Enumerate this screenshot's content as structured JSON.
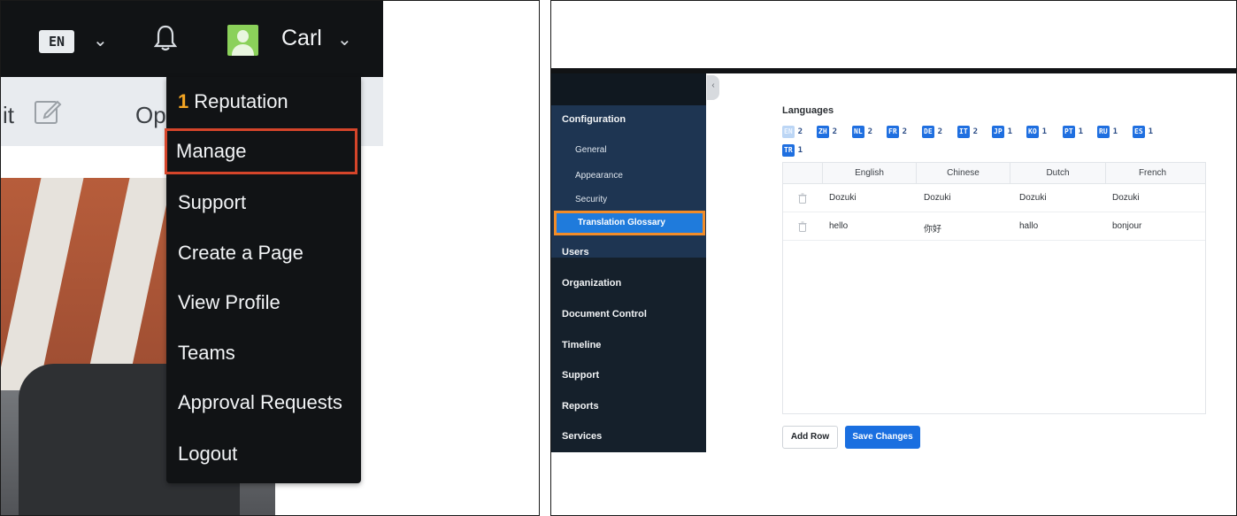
{
  "left": {
    "header": {
      "language_code": "EN",
      "user_name": "Carl"
    },
    "subbar": {
      "edit_fragment": "it",
      "options_fragment": "Op"
    },
    "dropdown": {
      "reputation_count": "1",
      "reputation_label": "Reputation",
      "items": [
        "Manage",
        "Support",
        "Create a Page",
        "View Profile",
        "Teams",
        "Approval Requests",
        "Logout"
      ],
      "highlighted": "Manage"
    },
    "colors": {
      "highlight": "#d5452a",
      "reputation": "#f5a623"
    }
  },
  "right": {
    "sidebar": {
      "sections": {
        "configuration": "Configuration",
        "users": "Users",
        "organization": "Organization",
        "document_control": "Document Control",
        "timeline": "Timeline",
        "support": "Support",
        "reports": "Reports",
        "services": "Services"
      },
      "config_items": [
        "General",
        "Appearance",
        "Security",
        "Translation Glossary"
      ],
      "active": "Translation Glossary"
    },
    "languages": {
      "title": "Languages",
      "chips": [
        {
          "code": "EN",
          "count": "2"
        },
        {
          "code": "ZH",
          "count": "2"
        },
        {
          "code": "NL",
          "count": "2"
        },
        {
          "code": "FR",
          "count": "2"
        },
        {
          "code": "DE",
          "count": "2"
        },
        {
          "code": "IT",
          "count": "2"
        },
        {
          "code": "JP",
          "count": "1"
        },
        {
          "code": "KO",
          "count": "1"
        },
        {
          "code": "PT",
          "count": "1"
        },
        {
          "code": "RU",
          "count": "1"
        },
        {
          "code": "ES",
          "count": "1"
        },
        {
          "code": "TR",
          "count": "1"
        }
      ]
    },
    "table": {
      "columns": [
        "English",
        "Chinese",
        "Dutch",
        "French"
      ],
      "rows": [
        [
          "Dozuki",
          "Dozuki",
          "Dozuki",
          "Dozuki"
        ],
        [
          "hello",
          "你好",
          "hallo",
          "bonjour"
        ]
      ]
    },
    "buttons": {
      "add_row": "Add Row",
      "save_changes": "Save Changes"
    },
    "colors": {
      "primary": "#1a6fe0",
      "active_outline": "#f28c28",
      "sidebar": "#15202b"
    }
  }
}
